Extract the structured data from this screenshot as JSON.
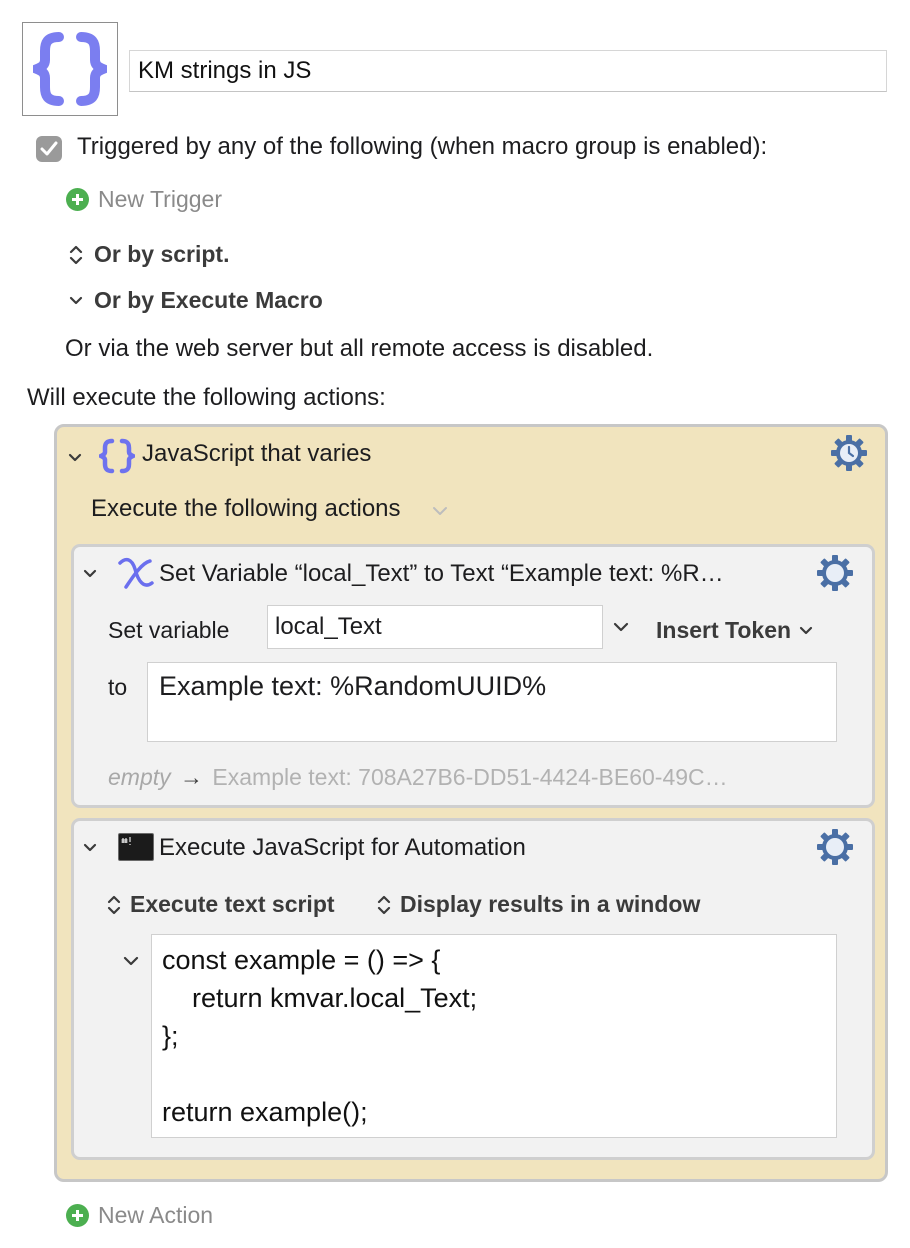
{
  "macro": {
    "name": "KM strings in JS"
  },
  "triggers": {
    "enabled_label": "Triggered by any of the following (when macro group is enabled):",
    "new_trigger_label": "New Trigger",
    "or_by_script_label": "Or by script.",
    "or_by_execute_macro_label": "Or by Execute Macro",
    "web_server_note": "Or via the web server but all remote access is disabled."
  },
  "actions_heading": "Will execute the following actions:",
  "group_action": {
    "title": "JavaScript that varies",
    "mode_label": "Execute the following actions"
  },
  "set_variable_action": {
    "title": "Set Variable “local_Text” to Text “Example text: %R…",
    "set_variable_label": "Set variable",
    "variable_name": "local_Text",
    "insert_token_label": "Insert Token",
    "to_label": "to",
    "text_value": "Example text: %RandomUUID%",
    "preview_empty": "empty",
    "preview_arrow": "→",
    "preview_result": "Example text: 708A27B6-DD51-4424-BE60-49C…"
  },
  "jxa_action": {
    "title": "Execute JavaScript for Automation",
    "script_source_label": "Execute text script",
    "results_label": "Display results in a window",
    "code_lines": [
      "const example = () => {",
      "    return kmvar.local_Text;",
      "};",
      "",
      "return example();"
    ]
  },
  "new_action_label": "New Action",
  "icons": {
    "macro": "curly-braces-icon",
    "group": "curly-braces-icon",
    "set_variable": "variable-x-icon",
    "jxa": "terminal-icon",
    "gear": "gear-icon",
    "plus": "plus-circle-icon"
  },
  "colors": {
    "braces_accent": "#7b7ef0",
    "group_background": "#f1e4be",
    "panel_background": "#f2f2f2",
    "plus_green": "#4caf50",
    "gear_blue": "#4a6fa5"
  }
}
